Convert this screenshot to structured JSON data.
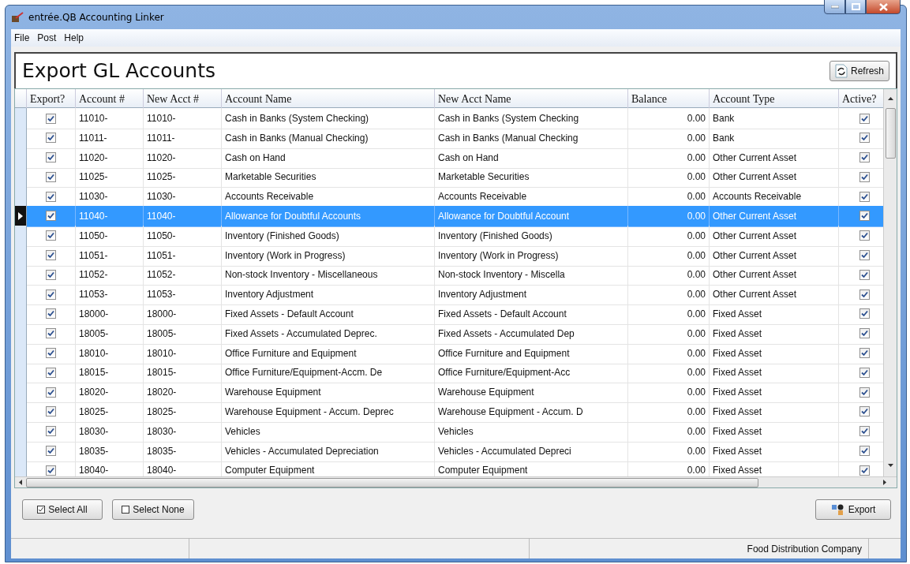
{
  "window": {
    "title": "entrée.QB Accounting Linker"
  },
  "menu": [
    "File",
    "Post",
    "Help"
  ],
  "header": {
    "title": "Export GL Accounts",
    "refresh_button": "Refresh"
  },
  "table": {
    "columns": [
      "Export?",
      "Account #",
      "New Acct #",
      "Account Name",
      "New Acct Name",
      "Balance",
      "Account Type",
      "Active?"
    ],
    "rows": [
      {
        "export": true,
        "account": "11010-",
        "new_account": "11010-",
        "name": "Cash in Banks (System Checking)",
        "new_name": "Cash in Banks (System Checking",
        "balance": "0.00",
        "type": "Bank",
        "active": true,
        "selected": false
      },
      {
        "export": true,
        "account": "11011-",
        "new_account": "11011-",
        "name": "Cash in Banks (Manual Checking)",
        "new_name": "Cash in Banks (Manual Checking",
        "balance": "0.00",
        "type": "Bank",
        "active": true,
        "selected": false
      },
      {
        "export": true,
        "account": "11020-",
        "new_account": "11020-",
        "name": "Cash on Hand",
        "new_name": "Cash on Hand",
        "balance": "0.00",
        "type": "Other Current Asset",
        "active": true,
        "selected": false
      },
      {
        "export": true,
        "account": "11025-",
        "new_account": "11025-",
        "name": "Marketable Securities",
        "new_name": "Marketable Securities",
        "balance": "0.00",
        "type": "Other Current Asset",
        "active": true,
        "selected": false
      },
      {
        "export": true,
        "account": "11030-",
        "new_account": "11030-",
        "name": "Accounts Receivable",
        "new_name": "Accounts Receivable",
        "balance": "0.00",
        "type": "Accounts Receivable",
        "active": true,
        "selected": false
      },
      {
        "export": true,
        "account": "11040-",
        "new_account": "11040-",
        "name": "Allowance for Doubtful Accounts",
        "new_name": "Allowance for Doubtful Account",
        "balance": "0.00",
        "type": "Other Current Asset",
        "active": true,
        "selected": true
      },
      {
        "export": true,
        "account": "11050-",
        "new_account": "11050-",
        "name": "Inventory (Finished Goods)",
        "new_name": "Inventory (Finished Goods)",
        "balance": "0.00",
        "type": "Other Current Asset",
        "active": true,
        "selected": false
      },
      {
        "export": true,
        "account": "11051-",
        "new_account": "11051-",
        "name": "Inventory (Work in Progress)",
        "new_name": "Inventory (Work in Progress)",
        "balance": "0.00",
        "type": "Other Current Asset",
        "active": true,
        "selected": false
      },
      {
        "export": true,
        "account": "11052-",
        "new_account": "11052-",
        "name": "Non-stock Inventory - Miscellaneous",
        "new_name": "Non-stock Inventory - Miscella",
        "balance": "0.00",
        "type": "Other Current Asset",
        "active": true,
        "selected": false
      },
      {
        "export": true,
        "account": "11053-",
        "new_account": "11053-",
        "name": "Inventory Adjustment",
        "new_name": "Inventory Adjustment",
        "balance": "0.00",
        "type": "Other Current Asset",
        "active": true,
        "selected": false
      },
      {
        "export": true,
        "account": "18000-",
        "new_account": "18000-",
        "name": "Fixed Assets - Default Account",
        "new_name": "Fixed Assets - Default Account",
        "balance": "0.00",
        "type": "Fixed Asset",
        "active": true,
        "selected": false
      },
      {
        "export": true,
        "account": "18005-",
        "new_account": "18005-",
        "name": "Fixed Assets - Accumulated Deprec.",
        "new_name": "Fixed Assets - Accumulated Dep",
        "balance": "0.00",
        "type": "Fixed Asset",
        "active": true,
        "selected": false
      },
      {
        "export": true,
        "account": "18010-",
        "new_account": "18010-",
        "name": "Office Furniture and Equipment",
        "new_name": "Office Furniture and Equipment",
        "balance": "0.00",
        "type": "Fixed Asset",
        "active": true,
        "selected": false
      },
      {
        "export": true,
        "account": "18015-",
        "new_account": "18015-",
        "name": "Office Furniture/Equipment-Accm. De",
        "new_name": "Office Furniture/Equipment-Acc",
        "balance": "0.00",
        "type": "Fixed Asset",
        "active": true,
        "selected": false
      },
      {
        "export": true,
        "account": "18020-",
        "new_account": "18020-",
        "name": "Warehouse Equipment",
        "new_name": "Warehouse Equipment",
        "balance": "0.00",
        "type": "Fixed Asset",
        "active": true,
        "selected": false
      },
      {
        "export": true,
        "account": "18025-",
        "new_account": "18025-",
        "name": "Warehouse Equipment - Accum. Deprec",
        "new_name": "Warehouse Equipment - Accum. D",
        "balance": "0.00",
        "type": "Fixed Asset",
        "active": true,
        "selected": false
      },
      {
        "export": true,
        "account": "18030-",
        "new_account": "18030-",
        "name": "Vehicles",
        "new_name": "Vehicles",
        "balance": "0.00",
        "type": "Fixed Asset",
        "active": true,
        "selected": false
      },
      {
        "export": true,
        "account": "18035-",
        "new_account": "18035-",
        "name": "Vehicles - Accumulated Depreciation",
        "new_name": "Vehicles - Accumulated Depreci",
        "balance": "0.00",
        "type": "Fixed Asset",
        "active": true,
        "selected": false
      },
      {
        "export": true,
        "account": "18040-",
        "new_account": "18040-",
        "name": "Computer Equipment",
        "new_name": "Computer Equipment",
        "balance": "0.00",
        "type": "Fixed Asset",
        "active": true,
        "selected": false
      }
    ]
  },
  "buttons": {
    "select_all": "Select All",
    "select_none": "Select None",
    "export": "Export"
  },
  "status_bar": {
    "company": "Food Distribution Company"
  }
}
